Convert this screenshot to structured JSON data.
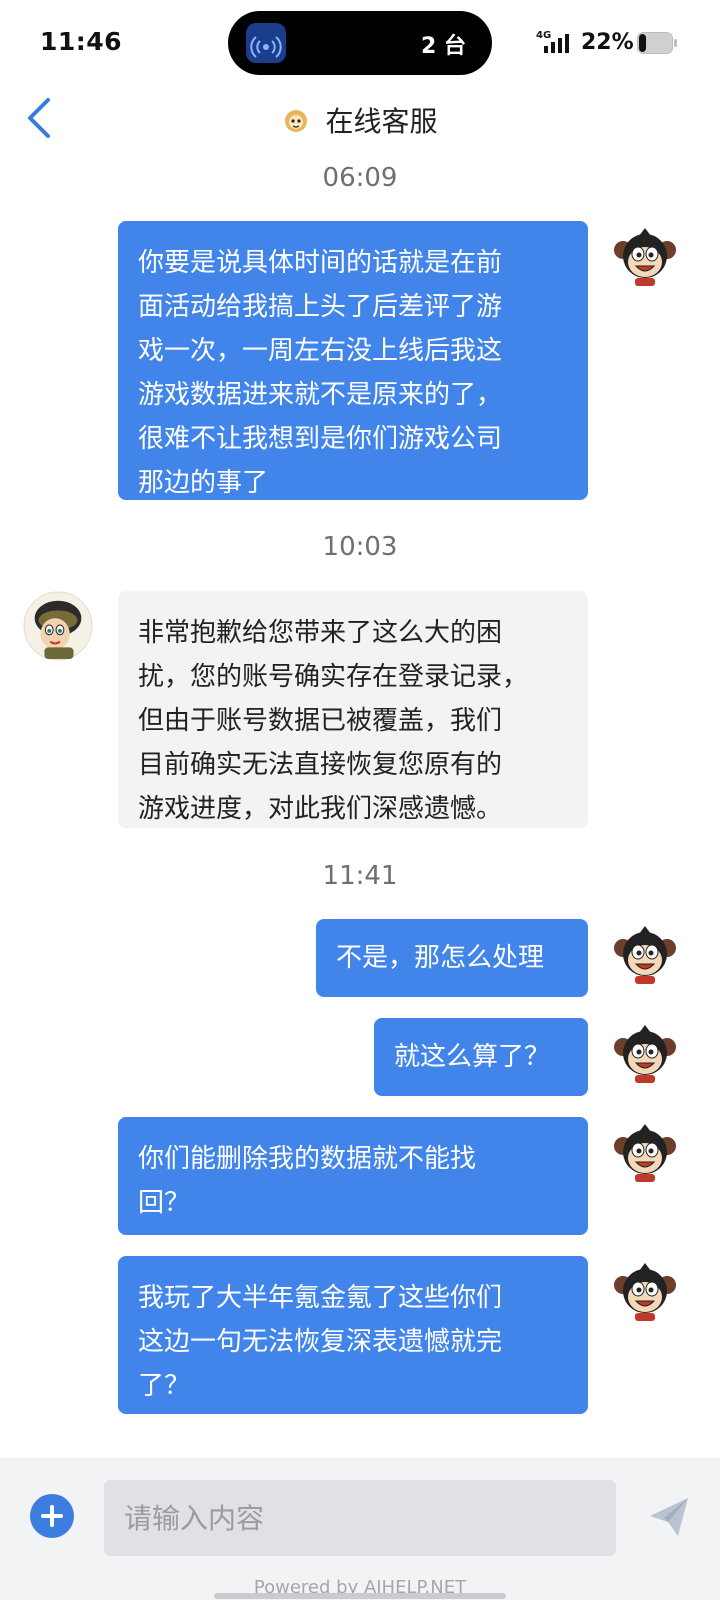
{
  "status_bar": {
    "time": "11:46",
    "island_text": "2 台",
    "network": "4G",
    "battery_percent": "22%",
    "battery_level": 0.22
  },
  "nav": {
    "title": "在线客服",
    "back_icon": "chevron-left-icon"
  },
  "messages": [
    {
      "type": "timestamp",
      "text": "06:09"
    },
    {
      "type": "bubble",
      "sender": "me",
      "lines": [
        "你要是说具体时间的话就是在前",
        "面活动给我搞上头了后差评了游",
        "戏一次，一周左右没上线后我这",
        "游戏数据进来就不是原来的了，",
        "很难不让我想到是你们游戏公司",
        "那边的事了"
      ]
    },
    {
      "type": "timestamp",
      "text": "10:03"
    },
    {
      "type": "bubble",
      "sender": "agent",
      "lines": [
        "非常抱歉给您带来了这么大的困",
        "扰，您的账号确实存在登录记录，",
        "但由于账号数据已被覆盖，我们",
        "目前确实无法直接恢复您原有的",
        "游戏进度，对此我们深感遗憾。"
      ]
    },
    {
      "type": "timestamp",
      "text": "11:41"
    },
    {
      "type": "bubble",
      "sender": "me",
      "lines": [
        "不是，那怎么处理"
      ]
    },
    {
      "type": "bubble",
      "sender": "me",
      "lines": [
        "就这么算了？"
      ]
    },
    {
      "type": "bubble",
      "sender": "me",
      "lines": [
        "你们能删除我的数据就不能找",
        "回？"
      ]
    },
    {
      "type": "bubble",
      "sender": "me",
      "lines": [
        "我玩了大半年氪金氪了这些你们",
        "这边一句无法恢复深表遗憾就完",
        "了？"
      ]
    }
  ],
  "input_bar": {
    "placeholder": "请输入内容",
    "value": "",
    "add_icon": "plus-circle-icon",
    "send_icon": "paper-plane-icon",
    "powered_by": "Powered by AIHELP.NET"
  },
  "colors": {
    "my_bubble": "#4285ea",
    "agent_bubble": "#f2f3f5",
    "accent": "#3d7ddf"
  }
}
